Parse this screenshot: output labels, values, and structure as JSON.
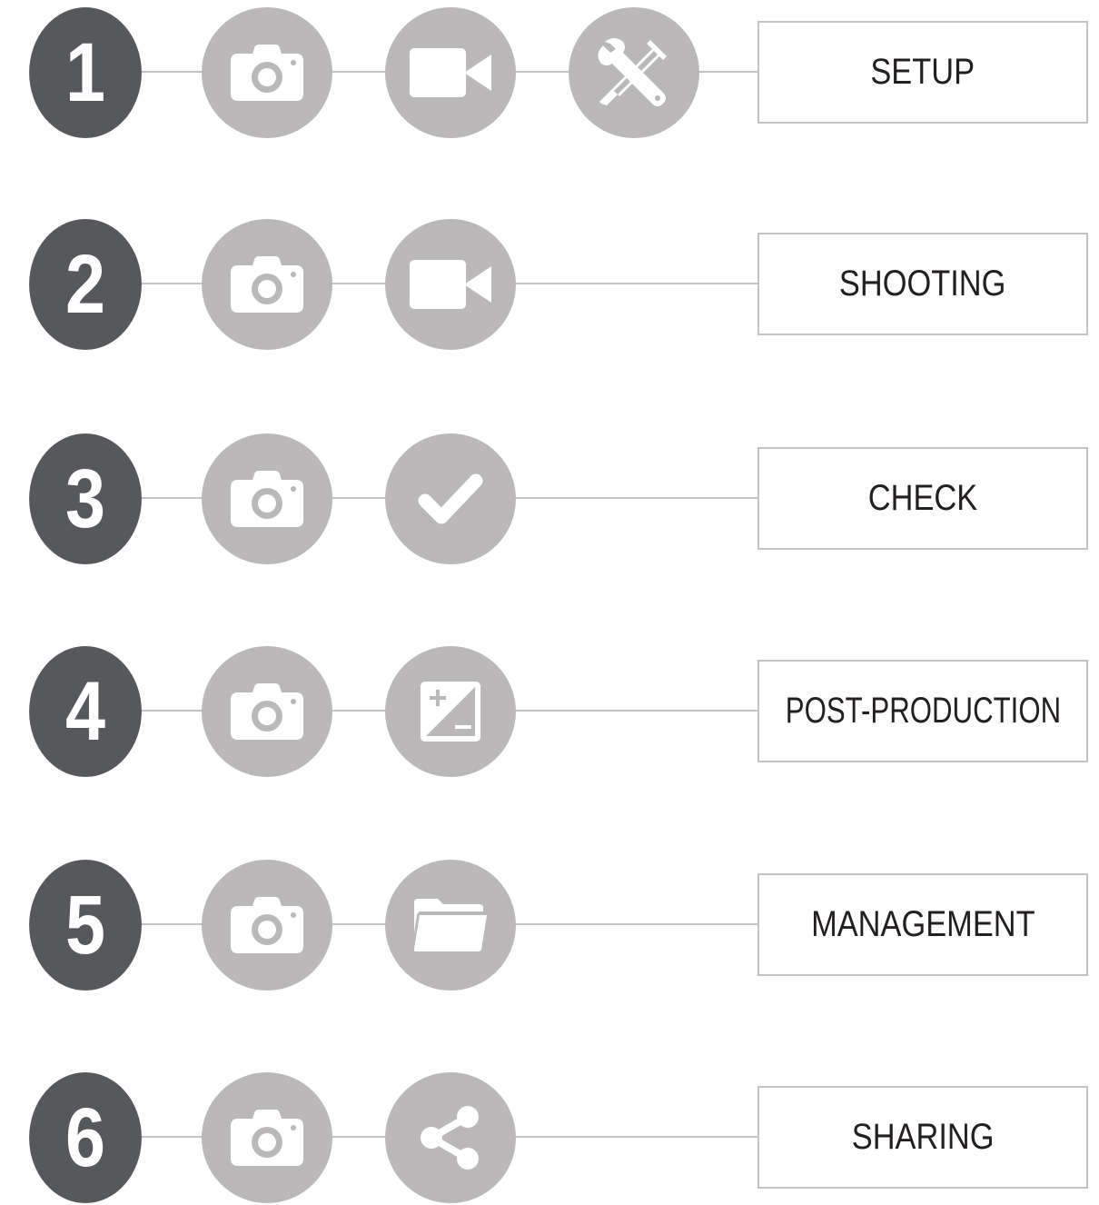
{
  "steps": [
    {
      "number": "1",
      "label": "SETUP",
      "icons": [
        "camera-icon",
        "video-camera-icon",
        "tools-icon"
      ]
    },
    {
      "number": "2",
      "label": "SHOOTING",
      "icons": [
        "camera-icon",
        "video-camera-icon"
      ]
    },
    {
      "number": "3",
      "label": "CHECK",
      "icons": [
        "camera-icon",
        "checkmark-icon"
      ]
    },
    {
      "number": "4",
      "label": "POST-PRODUCTION",
      "icons": [
        "camera-icon",
        "exposure-icon"
      ]
    },
    {
      "number": "5",
      "label": "MANAGEMENT",
      "icons": [
        "camera-icon",
        "folder-icon"
      ]
    },
    {
      "number": "6",
      "label": "SHARING",
      "icons": [
        "camera-icon",
        "share-icon"
      ]
    }
  ],
  "colors": {
    "number_circle": "#56585c",
    "icon_circle": "#bab8b9",
    "connector": "#c4c2c3",
    "label_text": "#231f20"
  }
}
